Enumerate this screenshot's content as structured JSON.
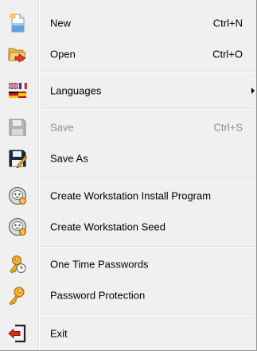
{
  "menu": {
    "items": [
      {
        "label": "New",
        "shortcut": "Ctrl+N",
        "icon": "new-document-icon",
        "enabled": true
      },
      {
        "label": "Open",
        "shortcut": "Ctrl+O",
        "icon": "open-folder-icon",
        "enabled": true
      },
      {
        "label": "Languages",
        "icon": "flags-icon",
        "enabled": true,
        "submenu": true
      },
      {
        "label": "Save",
        "shortcut": "Ctrl+S",
        "icon": "floppy-disk-icon",
        "enabled": false
      },
      {
        "label": "Save As",
        "icon": "floppy-disk-pencil-icon",
        "enabled": true
      },
      {
        "label": "Create Workstation Install Program",
        "icon": "workstation-install-icon",
        "enabled": true
      },
      {
        "label": "Create Workstation Seed",
        "icon": "workstation-seed-icon",
        "enabled": true
      },
      {
        "label": "One Time Passwords",
        "icon": "key-clock-icon",
        "enabled": true
      },
      {
        "label": "Password Protection",
        "icon": "key-icon",
        "enabled": true
      },
      {
        "label": "Exit",
        "icon": "exit-icon",
        "enabled": true
      }
    ]
  },
  "colors": {
    "menu_background": "#f0f0f0",
    "disabled_text": "#8d8d8d",
    "separator": "#e0e0e0"
  }
}
